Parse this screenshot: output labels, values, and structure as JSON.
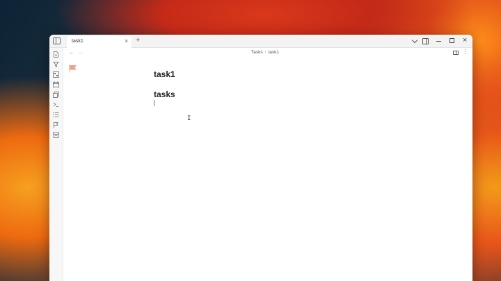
{
  "tabs": [
    {
      "label": "task1",
      "active": true
    }
  ],
  "breadcrumb": {
    "folder": "Tasks",
    "separator": "/",
    "file": "task1"
  },
  "note": {
    "title": "task1",
    "heading": "tasks"
  },
  "ribbon": {
    "icons": [
      "file-icon",
      "graph-icon",
      "canvas-icon",
      "calendar-icon",
      "copy-icon",
      "terminal-icon",
      "list-icon",
      "flag-icon",
      "archive-icon"
    ]
  },
  "colors": {
    "accent_flag": "#f2a08a",
    "window_bg": "#ffffff",
    "titlebar_bg": "#f3f3f3"
  }
}
